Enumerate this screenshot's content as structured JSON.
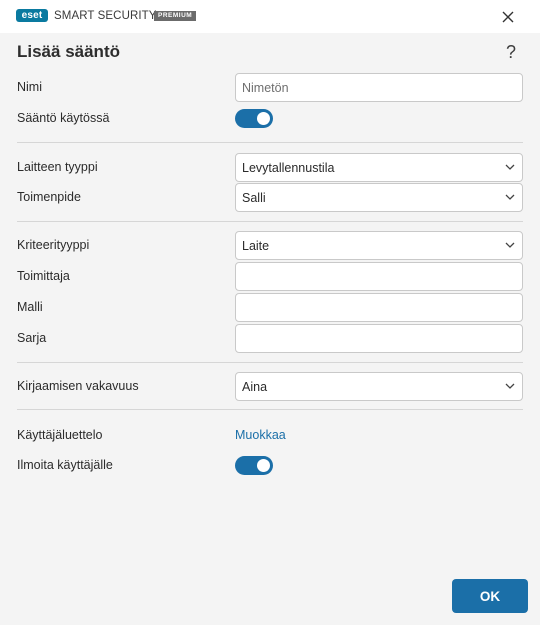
{
  "titlebar": {
    "logo": "eset",
    "product_name": "SMART SECURITY",
    "edition": "PREMIUM",
    "close_icon": "close-icon"
  },
  "dialog": {
    "title": "Lisää sääntö",
    "help_label": "?"
  },
  "form": {
    "name": {
      "label": "Nimi",
      "placeholder": "Nimetön",
      "value": ""
    },
    "rule_enabled": {
      "label": "Sääntö käytössä",
      "on": true
    },
    "device_type": {
      "label": "Laitteen tyyppi",
      "value": "Levytallennustila"
    },
    "action": {
      "label": "Toimenpide",
      "value": "Salli"
    },
    "criteria_type": {
      "label": "Kriteerityyppi",
      "value": "Laite"
    },
    "vendor": {
      "label": "Toimittaja",
      "value": ""
    },
    "model": {
      "label": "Malli",
      "value": ""
    },
    "serial": {
      "label": "Sarja",
      "value": ""
    },
    "log_severity": {
      "label": "Kirjaamisen vakavuus",
      "value": "Aina"
    },
    "user_list": {
      "label": "Käyttäjäluettelo",
      "link_text": "Muokkaa"
    },
    "notify_user": {
      "label": "Ilmoita käyttäjälle",
      "on": true
    }
  },
  "footer": {
    "ok_label": "OK"
  },
  "colors": {
    "accent": "#1b6fa8",
    "logo": "#0a7aa0"
  }
}
